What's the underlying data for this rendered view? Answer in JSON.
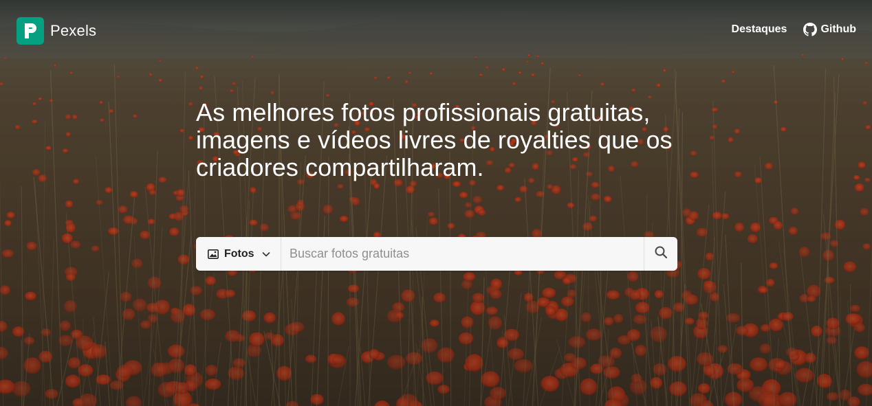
{
  "brand": {
    "name": "Pexels",
    "color": "#05a081"
  },
  "nav": {
    "links": [
      {
        "label": "Destaques"
      },
      {
        "label": "Github",
        "icon": "github-icon"
      }
    ]
  },
  "hero": {
    "headline": "As melhores fotos profissionais gratuitas, imagens e vídeos livres de royalties que os criadores compartilharam.",
    "background": "poppy field photo"
  },
  "search": {
    "type_label": "Fotos",
    "type_icon": "image-icon",
    "placeholder": "Buscar fotos gratuitas",
    "value": "",
    "button_icon": "search-icon"
  }
}
